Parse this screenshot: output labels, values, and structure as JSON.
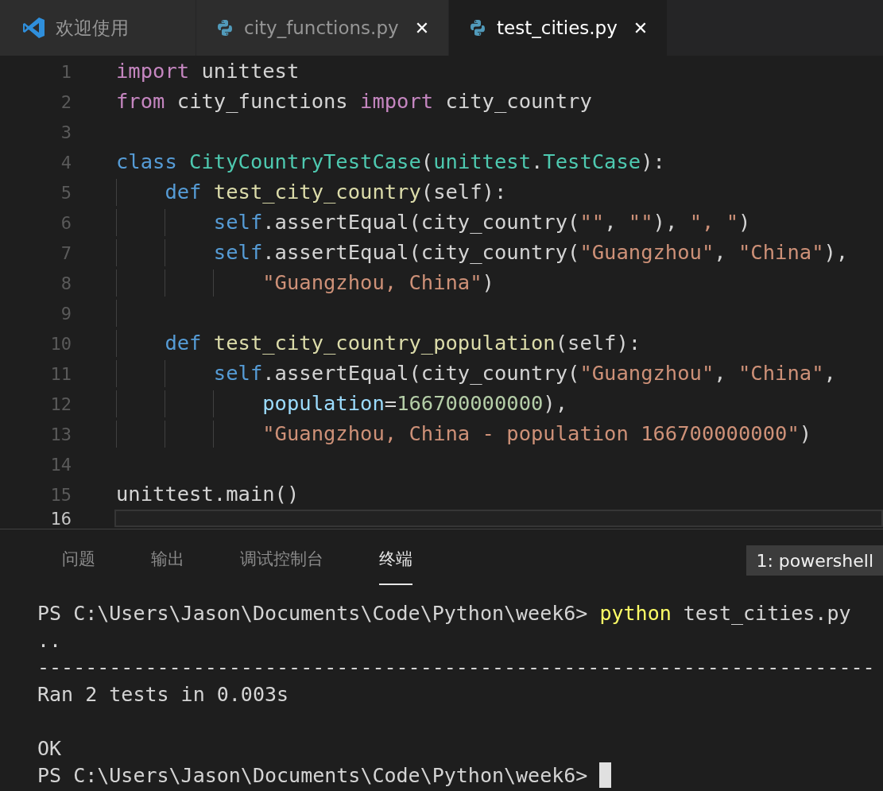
{
  "tabs": [
    {
      "label": "欢迎使用",
      "kind": "welcome",
      "selected": false,
      "closable": false
    },
    {
      "label": "city_functions.py",
      "kind": "python",
      "selected": false,
      "closable": true
    },
    {
      "label": "test_cities.py",
      "kind": "python",
      "selected": true,
      "closable": true
    }
  ],
  "close_glyph": "✕",
  "editor": {
    "lines": [
      {
        "number": "1",
        "current": false,
        "tokens": [
          {
            "t": "import",
            "kind": "control"
          },
          {
            "t": " unittest",
            "kind": "plain"
          }
        ]
      },
      {
        "number": "2",
        "current": false,
        "tokens": [
          {
            "t": "from",
            "kind": "control"
          },
          {
            "t": " city_functions ",
            "kind": "plain"
          },
          {
            "t": "import",
            "kind": "control"
          },
          {
            "t": " city_country",
            "kind": "plain"
          }
        ]
      },
      {
        "number": "3",
        "current": false
      },
      {
        "number": "4",
        "current": false,
        "tokens": [
          {
            "t": "class",
            "kind": "keyword"
          },
          {
            "t": " CityCountryTestCase",
            "kind": "type"
          },
          {
            "t": "(",
            "kind": "plain"
          },
          {
            "t": "unittest",
            "kind": "type"
          },
          {
            "t": ".",
            "kind": "plain"
          },
          {
            "t": "TestCase",
            "kind": "type"
          },
          {
            "t": "):",
            "kind": "plain"
          }
        ]
      },
      {
        "number": "5",
        "current": false,
        "tokens": [
          {
            "t": "    def",
            "kind": "keyword"
          },
          {
            "t": " test_city_country",
            "kind": "function"
          },
          {
            "t": "(self):",
            "kind": "plain"
          }
        ]
      },
      {
        "number": "6",
        "current": false,
        "tokens": [
          {
            "t": "        self",
            "kind": "keyword"
          },
          {
            "t": ".assertEqual(city_country(",
            "kind": "plain"
          },
          {
            "t": "\"\"",
            "kind": "string"
          },
          {
            "t": ", ",
            "kind": "plain"
          },
          {
            "t": "\"\"",
            "kind": "string"
          },
          {
            "t": "), ",
            "kind": "plain"
          },
          {
            "t": "\", \"",
            "kind": "string"
          },
          {
            "t": ")",
            "kind": "plain"
          }
        ]
      },
      {
        "number": "7",
        "current": false,
        "tokens": [
          {
            "t": "        self",
            "kind": "keyword"
          },
          {
            "t": ".assertEqual(city_country(",
            "kind": "plain"
          },
          {
            "t": "\"Guangzhou\"",
            "kind": "string"
          },
          {
            "t": ", ",
            "kind": "plain"
          },
          {
            "t": "\"China\"",
            "kind": "string"
          },
          {
            "t": "),",
            "kind": "plain"
          }
        ]
      },
      {
        "number": "8",
        "current": false,
        "tokens": [
          {
            "t": "            \"Guangzhou, China\"",
            "kind": "string"
          },
          {
            "t": ")",
            "kind": "plain"
          }
        ]
      },
      {
        "number": "9",
        "current": false
      },
      {
        "number": "10",
        "current": false,
        "tokens": [
          {
            "t": "    def",
            "kind": "keyword"
          },
          {
            "t": " test_city_country_population",
            "kind": "function"
          },
          {
            "t": "(self):",
            "kind": "plain"
          }
        ]
      },
      {
        "number": "11",
        "current": false,
        "tokens": [
          {
            "t": "        self",
            "kind": "keyword"
          },
          {
            "t": ".assertEqual(city_country(",
            "kind": "plain"
          },
          {
            "t": "\"Guangzhou\"",
            "kind": "string"
          },
          {
            "t": ", ",
            "kind": "plain"
          },
          {
            "t": "\"China\"",
            "kind": "string"
          },
          {
            "t": ",",
            "kind": "plain"
          }
        ]
      },
      {
        "number": "12",
        "current": false,
        "tokens": [
          {
            "t": "            population",
            "kind": "param"
          },
          {
            "t": "=",
            "kind": "plain"
          },
          {
            "t": "166700000000",
            "kind": "number"
          },
          {
            "t": "),",
            "kind": "plain"
          }
        ]
      },
      {
        "number": "13",
        "current": false,
        "tokens": [
          {
            "t": "            \"Guangzhou, China - population 166700000000\"",
            "kind": "string"
          },
          {
            "t": ")",
            "kind": "plain"
          }
        ]
      },
      {
        "number": "14",
        "current": false
      },
      {
        "number": "15",
        "current": false,
        "tokens": [
          {
            "t": "unittest.main()",
            "kind": "plain"
          }
        ]
      },
      {
        "number": "16",
        "current": true
      }
    ]
  },
  "panel": {
    "tabs": [
      {
        "label": "问题",
        "selected": false
      },
      {
        "label": "输出",
        "selected": false
      },
      {
        "label": "调试控制台",
        "selected": false
      },
      {
        "label": "终端",
        "selected": true
      }
    ],
    "terminal_selector": "1: powershell",
    "terminal_lines": [
      {
        "segments": [
          {
            "t": "PS C:\\Users\\Jason\\Documents\\Code\\Python\\week6> ",
            "kind": "plain"
          },
          {
            "t": "python",
            "kind": "command"
          },
          {
            "t": " test_cities.py",
            "kind": "plain"
          }
        ],
        "cursor": false
      },
      {
        "segments": [
          {
            "t": "..",
            "kind": "plain"
          }
        ],
        "cursor": false
      },
      {
        "segments": [
          {
            "t": "----------------------------------------------------------------------",
            "kind": "plain"
          }
        ],
        "cursor": false
      },
      {
        "segments": [
          {
            "t": "Ran 2 tests in 0.003s",
            "kind": "plain"
          }
        ],
        "cursor": false
      },
      {
        "cursor": false
      },
      {
        "segments": [
          {
            "t": "OK",
            "kind": "plain"
          }
        ],
        "cursor": false
      },
      {
        "segments": [
          {
            "t": "PS C:\\Users\\Jason\\Documents\\Code\\Python\\week6> ",
            "kind": "plain"
          }
        ],
        "cursor": true
      }
    ]
  }
}
